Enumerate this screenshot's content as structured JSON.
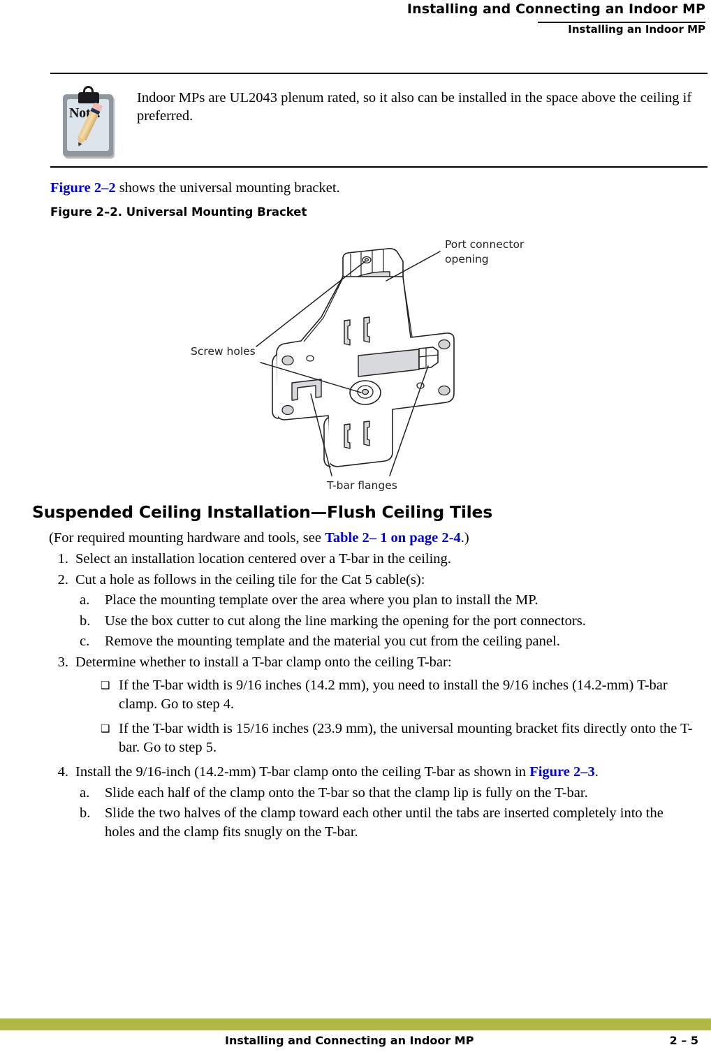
{
  "header": {
    "title": "Installing and Connecting an Indoor MP",
    "subtitle": "Installing an Indoor MP"
  },
  "note": {
    "icon_label": "Note:",
    "text": "Indoor MPs are UL2043 plenum rated, so it also can be installed in the space above the ceiling if preferred."
  },
  "intro": {
    "link": "Figure 2–2",
    "rest": " shows the universal mounting bracket."
  },
  "figure": {
    "caption": "Figure 2–2.  Universal Mounting Bracket",
    "labels": {
      "port_connector_line1": "Port connector",
      "port_connector_line2": "opening",
      "screw_holes": "Screw holes",
      "tbar_flanges": "T-bar flanges"
    }
  },
  "section": {
    "heading": "Suspended Ceiling Installation—Flush Ceiling Tiles",
    "intro_prefix": "(For required mounting hardware and tools, see ",
    "intro_link": "Table 2– 1 on page 2-4",
    "intro_suffix": ".)"
  },
  "steps": [
    {
      "marker": "1.",
      "text": "Select an installation location centered over a T-bar in the ceiling."
    },
    {
      "marker": "2.",
      "text": "Cut a hole as follows in the ceiling tile for the Cat 5 cable(s):",
      "substeps": [
        {
          "marker": "a.",
          "text": "Place the mounting template over the area where you plan to install the MP."
        },
        {
          "marker": "b.",
          "text": "Use the box cutter to cut along the line marking the opening for the port connectors."
        },
        {
          "marker": "c.",
          "text": "Remove the mounting template and the material you cut from the ceiling panel."
        }
      ]
    },
    {
      "marker": "3.",
      "text": "Determine whether to install a T-bar clamp onto the ceiling T-bar:",
      "bullets": [
        {
          "marker": "❑",
          "text": "If the T-bar width is 9/16 inches (14.2 mm), you need to install the 9/16 inches (14.2-mm) T-bar clamp. Go to step 4."
        },
        {
          "marker": "❑",
          "text": "If the T-bar width is 15/16 inches (23.9 mm), the universal mounting bracket fits directly onto the T-bar. Go to step 5."
        }
      ]
    },
    {
      "marker": "4.",
      "text_prefix": "Install the 9/16-inch (14.2-mm) T-bar clamp onto the ceiling T-bar as shown in ",
      "text_link": "Figure 2–3",
      "text_suffix": ".",
      "substeps": [
        {
          "marker": "a.",
          "text": "Slide each half of the clamp onto the T-bar so that the clamp lip is fully on the T-bar."
        },
        {
          "marker": "b.",
          "text": "Slide the two halves of the clamp toward each other until the tabs are inserted completely into the holes and the clamp fits snugly on the T-bar."
        }
      ]
    }
  ],
  "footer": {
    "left": "Installing and Connecting an Indoor MP",
    "page": "2 – 5",
    "bar_color": "#b0b846"
  }
}
